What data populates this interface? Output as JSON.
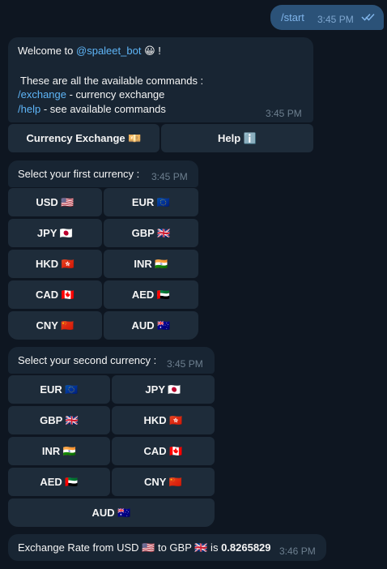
{
  "outgoing": {
    "text": "/start",
    "time": "3:45 PM",
    "status_icon": "double-check-icon"
  },
  "welcome": {
    "prefix": "Welcome to ",
    "bot_mention": "@spaleet_bot",
    "emoji": "😀",
    "suffix": " !",
    "intro": "These are all the available commands :",
    "commands": [
      {
        "cmd": "/exchange",
        "desc": " - currency exchange"
      },
      {
        "cmd": "/help",
        "desc": " - see available commands"
      }
    ],
    "time": "3:45 PM",
    "buttons": [
      "Currency Exchange 💴",
      "Help ℹ️"
    ]
  },
  "first_currency": {
    "prompt": "Select your first currency :",
    "time": "3:45 PM",
    "options": [
      "USD 🇺🇸",
      "EUR 🇪🇺",
      "JPY 🇯🇵",
      "GBP 🇬🇧",
      "HKD 🇭🇰",
      "INR 🇮🇳",
      "CAD 🇨🇦",
      "AED 🇦🇪",
      "CNY 🇨🇳",
      "AUD 🇦🇺"
    ]
  },
  "second_currency": {
    "prompt": "Select your second currency :",
    "time": "3:45 PM",
    "options": [
      "EUR 🇪🇺",
      "JPY 🇯🇵",
      "GBP 🇬🇧",
      "HKD 🇭🇰",
      "INR 🇮🇳",
      "CAD 🇨🇦",
      "AED 🇦🇪",
      "CNY 🇨🇳",
      "AUD 🇦🇺"
    ]
  },
  "result": {
    "text": "Exchange Rate from USD 🇺🇸 to GBP 🇬🇧 is ",
    "rate": "0.8265829",
    "time": "3:46 PM"
  }
}
